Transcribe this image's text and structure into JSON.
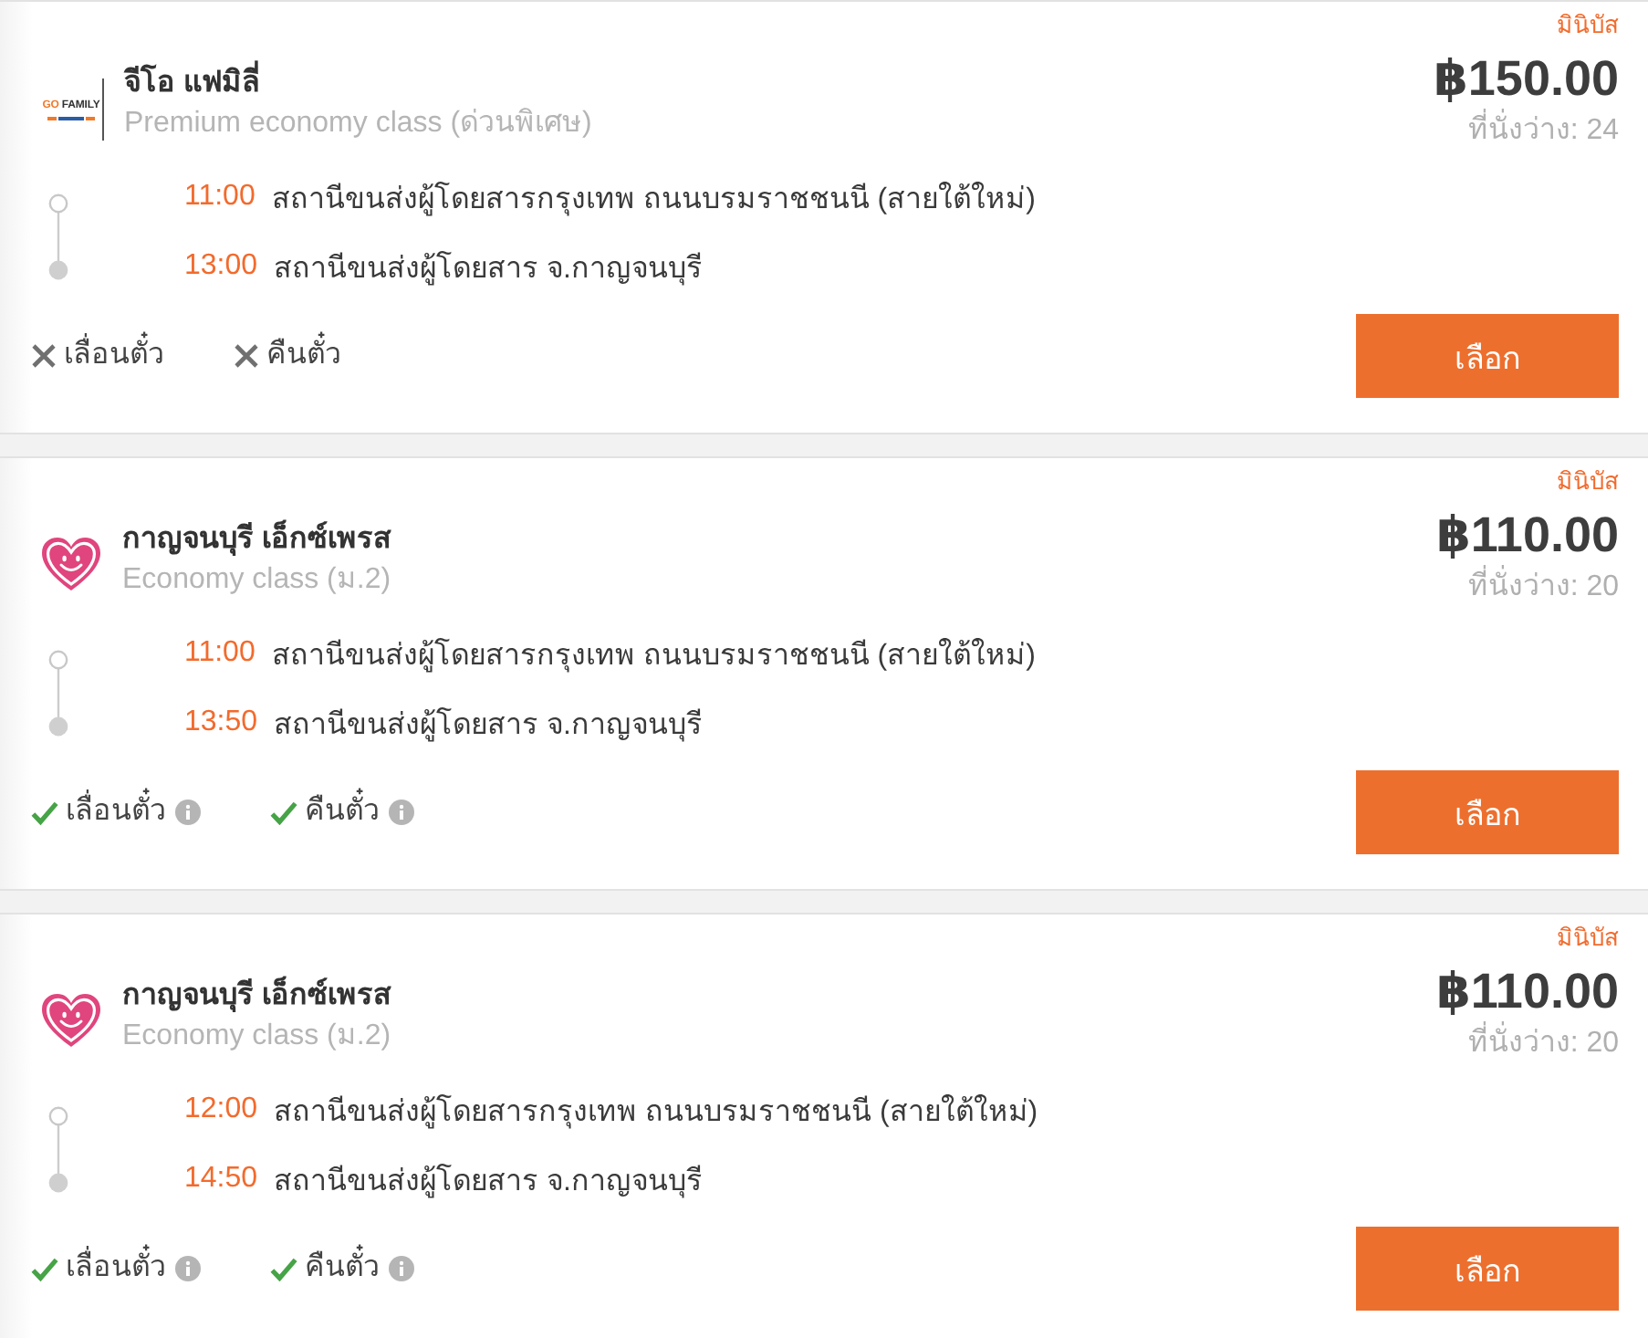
{
  "trips": [
    {
      "operator": {
        "name": "จีโอ แฟมิลี่",
        "logo": {
          "kind": "wordmark",
          "accent": "GO",
          "text": "FAMILY"
        }
      },
      "class": "Premium economy class (ด่วนพิเศษ)",
      "stops": [
        {
          "kind": "departure",
          "time": "11:00",
          "station": "สถานีขนส่งผู้โดยสารกรุงเทพ ถนนบรมราชชนนี (สายใต้ใหม่)"
        },
        {
          "kind": "arrival",
          "time": "13:00",
          "station": "สถานีขนส่งผู้โดยสาร จ.กาญจนบุรี"
        }
      ],
      "policies": [
        {
          "label": "เลื่อนตั๋ว",
          "allowed": false,
          "info": false
        },
        {
          "label": "คืนตั๋ว",
          "allowed": false,
          "info": false
        }
      ],
      "vehicle": "มินิบัส",
      "price": "฿150.00",
      "seats": "ที่นั่งว่าง: 24",
      "button": "เลือก"
    },
    {
      "operator": {
        "name": "กาญจนบุรี เอ็กซ์เพรส",
        "logo": {
          "kind": "heart"
        }
      },
      "class": "Economy class (ม.2)",
      "stops": [
        {
          "kind": "departure",
          "time": "11:00",
          "station": "สถานีขนส่งผู้โดยสารกรุงเทพ ถนนบรมราชชนนี (สายใต้ใหม่)"
        },
        {
          "kind": "arrival",
          "time": "13:50",
          "station": "สถานีขนส่งผู้โดยสาร จ.กาญจนบุรี"
        }
      ],
      "policies": [
        {
          "label": "เลื่อนตั๋ว",
          "allowed": true,
          "info": true
        },
        {
          "label": "คืนตั๋ว",
          "allowed": true,
          "info": true
        }
      ],
      "vehicle": "มินิบัส",
      "price": "฿110.00",
      "seats": "ที่นั่งว่าง: 20",
      "button": "เลือก"
    },
    {
      "operator": {
        "name": "กาญจนบุรี เอ็กซ์เพรส",
        "logo": {
          "kind": "heart"
        }
      },
      "class": "Economy class (ม.2)",
      "stops": [
        {
          "kind": "departure",
          "time": "12:00",
          "station": "สถานีขนส่งผู้โดยสารกรุงเทพ ถนนบรมราชชนนี (สายใต้ใหม่)"
        },
        {
          "kind": "arrival",
          "time": "14:50",
          "station": "สถานีขนส่งผู้โดยสาร จ.กาญจนบุรี"
        }
      ],
      "policies": [
        {
          "label": "เลื่อนตั๋ว",
          "allowed": true,
          "info": true
        },
        {
          "label": "คืนตั๋ว",
          "allowed": true,
          "info": true
        }
      ],
      "vehicle": "มินิบัส",
      "price": "฿110.00",
      "seats": "ที่นั่งว่าง: 20",
      "button": "เลือก"
    }
  ]
}
